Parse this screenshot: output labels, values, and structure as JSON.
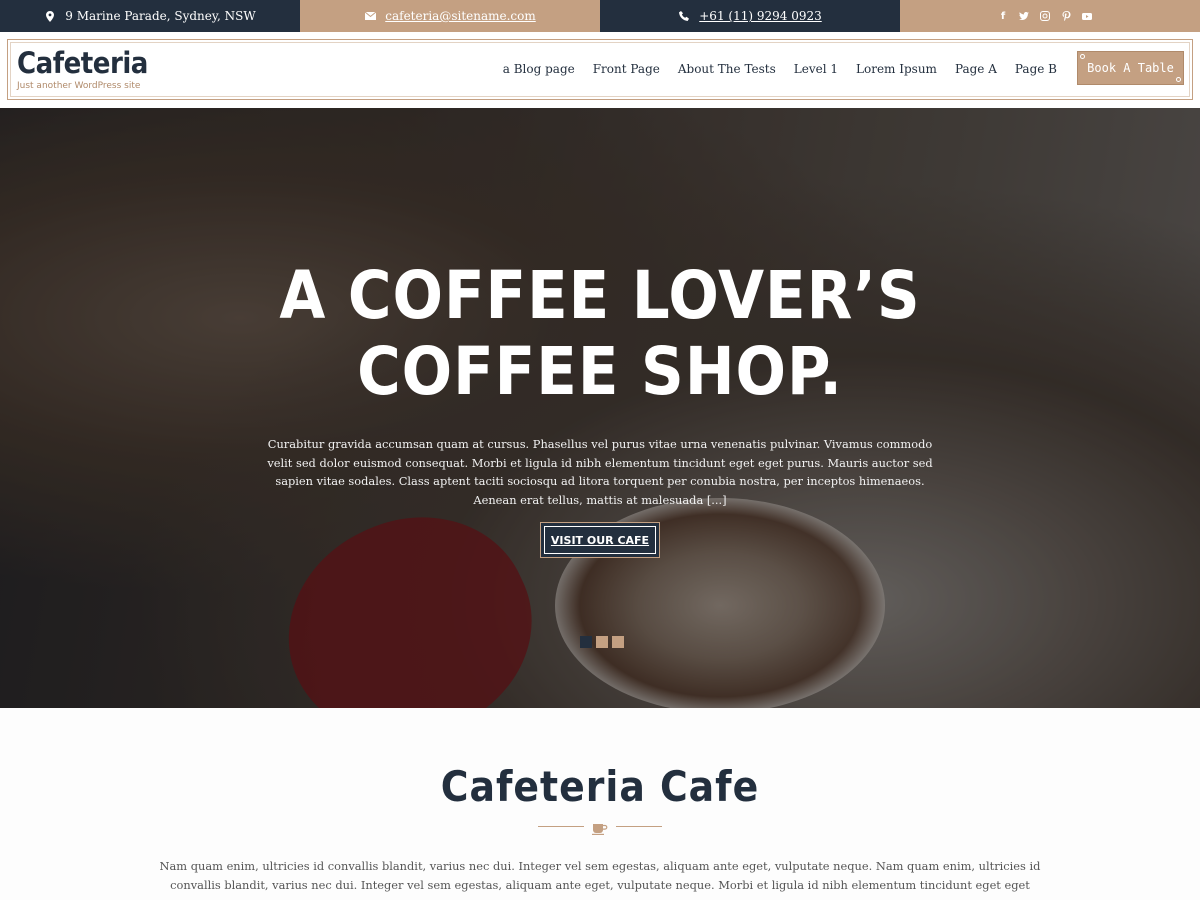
{
  "topbar": {
    "address": "9 Marine Parade, Sydney, NSW",
    "email": "cafeteria@sitename.com",
    "phone": "+61 (11) 9294 0923",
    "socials": [
      "facebook-icon",
      "twitter-icon",
      "instagram-icon",
      "pinterest-icon",
      "youtube-icon"
    ]
  },
  "header": {
    "title": "Cafeteria",
    "tagline": "Just another WordPress site",
    "nav": [
      "a Blog page",
      "Front Page",
      "About The Tests",
      "Level 1",
      "Lorem Ipsum",
      "Page A",
      "Page B"
    ],
    "cta": "Book A Table"
  },
  "hero": {
    "title_line1": "A COFFEE LOVER’S",
    "title_line2": "COFFEE SHOP.",
    "text": "Curabitur gravida accumsan quam at cursus. Phasellus vel purus vitae urna venenatis pulvinar. Vivamus commodo velit sed dolor euismod consequat. Morbi et ligula id nibh elementum tincidunt eget eget purus. Mauris auctor sed sapien vitae sodales. Class aptent taciti sociosqu ad litora torquent per conubia nostra, per inceptos himenaeos. Aenean erat tellus, mattis at malesuada [...]",
    "button": "VISIT OUR CAFE",
    "slides": 3,
    "active_slide": 1
  },
  "about": {
    "title": "Cafeteria Cafe",
    "text": "Nam quam enim, ultricies id convallis blandit, varius nec dui. Integer vel sem egestas, aliquam ante eget, vulputate neque. Nam quam enim, ultricies id convallis blandit, varius nec dui. Integer vel sem egestas, aliquam ante eget, vulputate neque. Morbi et ligula id nibh elementum tincidunt eget eget purus."
  },
  "colors": {
    "dark": "#232f3e",
    "accent": "#c4a082"
  }
}
